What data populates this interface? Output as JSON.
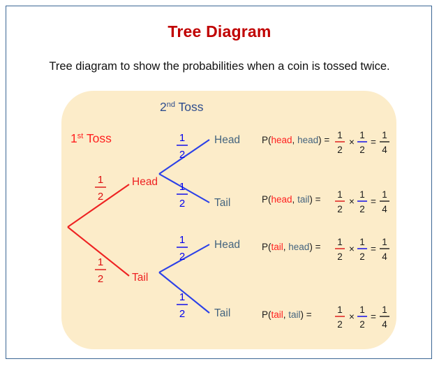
{
  "header": {
    "title": "Tree Diagram",
    "subtitle": "Tree diagram to show the probabilities when a coin is tossed twice."
  },
  "colors": {
    "title_red": "#C00000",
    "border_blue": "#3B6694",
    "panel_bg": "#FCECC9",
    "branch_red": "#EE2222",
    "branch_blue": "#2B40E8",
    "toss1_red": "#FF2020",
    "toss2_blue": "#2E4D8E",
    "node2_slate": "#44647F"
  },
  "diagram": {
    "stage1_label": {
      "num": "1",
      "sup": "st",
      "word": "Toss"
    },
    "stage2_label": {
      "num": "2",
      "sup": "nd",
      "word": "Toss"
    },
    "stage1_nodes": [
      {
        "label": "Head",
        "prob_num": "1",
        "prob_den": "2"
      },
      {
        "label": "Tail",
        "prob_num": "1",
        "prob_den": "2"
      }
    ],
    "stage2_nodes": [
      {
        "label": "Head",
        "prob_num": "1",
        "prob_den": "2"
      },
      {
        "label": "Tail",
        "prob_num": "1",
        "prob_den": "2"
      },
      {
        "label": "Head",
        "prob_num": "1",
        "prob_den": "2"
      },
      {
        "label": "Tail",
        "prob_num": "1",
        "prob_den": "2"
      }
    ],
    "outcomes": [
      {
        "p_open": "P(",
        "first": "head",
        "comma": ", ",
        "second": "head",
        "close": ") = ",
        "f1n": "1",
        "f1d": "2",
        "times": "×",
        "f2n": "1",
        "f2d": "2",
        "equals": "=",
        "resn": "1",
        "resd": "4"
      },
      {
        "p_open": "P(",
        "first": "head",
        "comma": ", ",
        "second": "tail",
        "close": ") = ",
        "f1n": "1",
        "f1d": "2",
        "times": "×",
        "f2n": "1",
        "f2d": "2",
        "equals": "=",
        "resn": "1",
        "resd": "4"
      },
      {
        "p_open": "P(",
        "first": "tail",
        "comma": ", ",
        "second": "head",
        "close": ") = ",
        "f1n": "1",
        "f1d": "2",
        "times": "×",
        "f2n": "1",
        "f2d": "2",
        "equals": "=",
        "resn": "1",
        "resd": "4"
      },
      {
        "p_open": "P(",
        "first": "tail",
        "comma": ", ",
        "second": "tail",
        "close": ") = ",
        "f1n": "1",
        "f1d": "2",
        "times": "×",
        "f2n": "1",
        "f2d": "2",
        "equals": "=",
        "resn": "1",
        "resd": "4"
      }
    ]
  }
}
